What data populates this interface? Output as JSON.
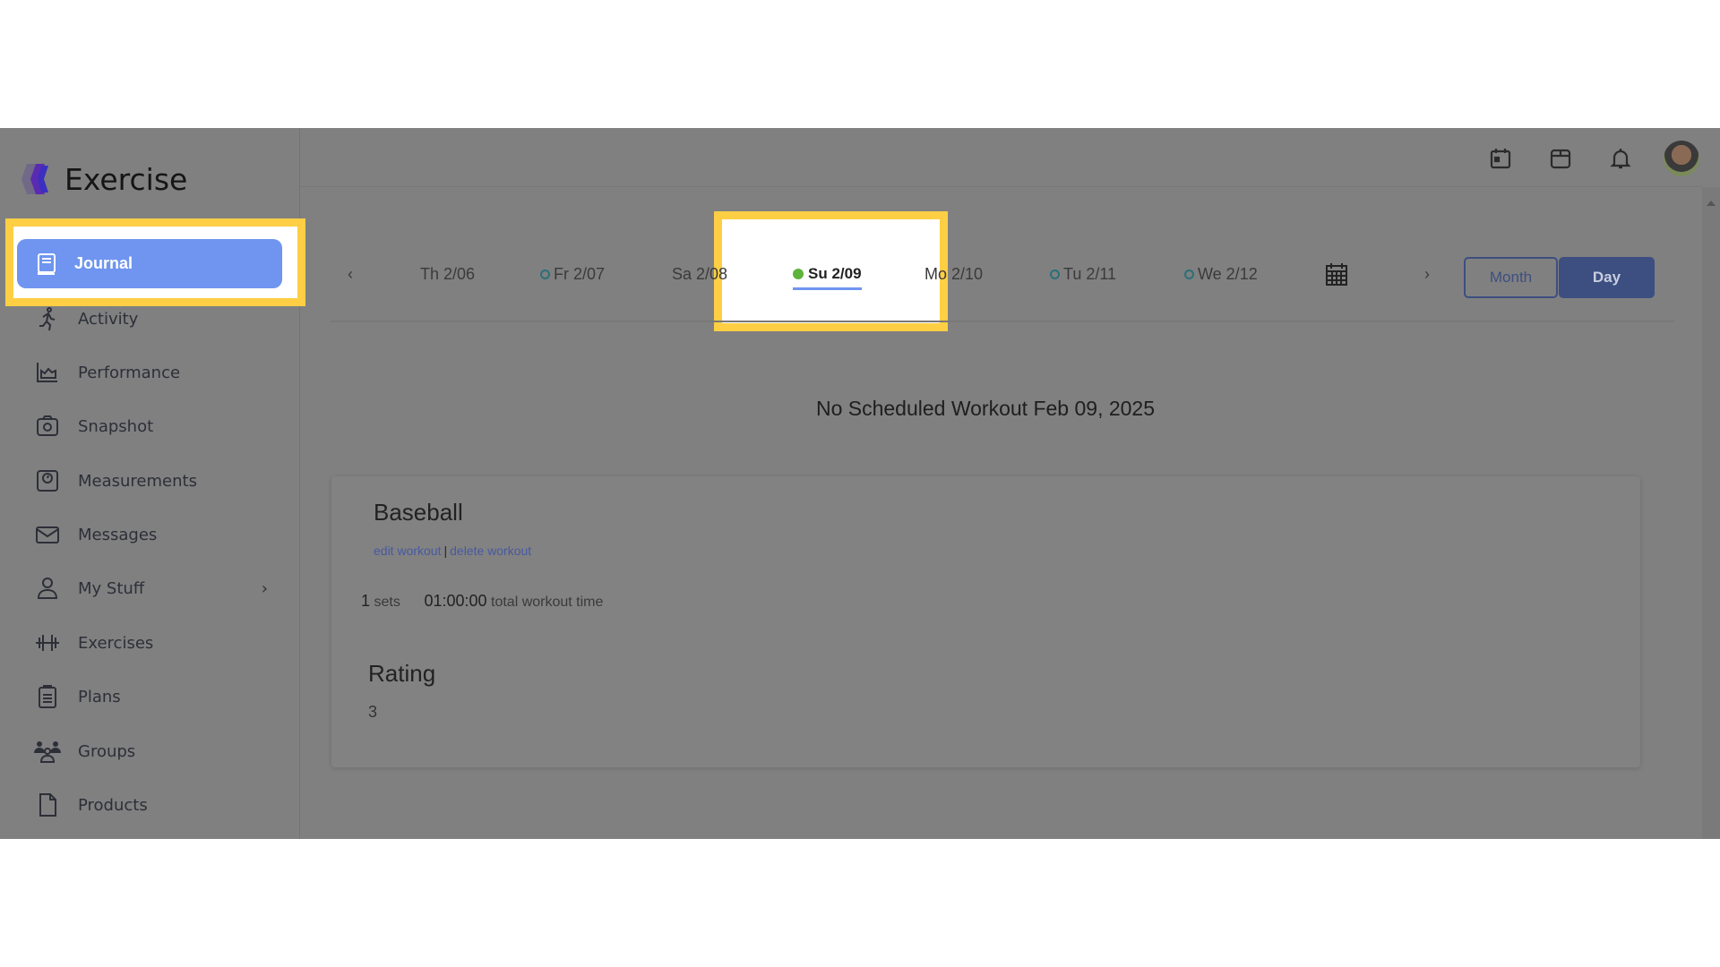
{
  "app": {
    "title": "Exercise"
  },
  "sidebar": {
    "items": [
      {
        "label": "Journal",
        "icon": "journal-icon",
        "active": true
      },
      {
        "label": "Activity",
        "icon": "running-icon"
      },
      {
        "label": "Performance",
        "icon": "chart-icon"
      },
      {
        "label": "Snapshot",
        "icon": "camera-icon"
      },
      {
        "label": "Measurements",
        "icon": "scale-icon"
      },
      {
        "label": "Messages",
        "icon": "mail-icon"
      },
      {
        "label": "My Stuff",
        "icon": "user-icon",
        "has_children": true
      },
      {
        "label": "Exercises",
        "icon": "dumbbell-icon"
      },
      {
        "label": "Plans",
        "icon": "clipboard-icon"
      },
      {
        "label": "Groups",
        "icon": "group-icon"
      },
      {
        "label": "Products",
        "icon": "file-icon"
      }
    ]
  },
  "topbar": {
    "icons": [
      "calendar-icon",
      "box-icon",
      "bell-icon",
      "avatar"
    ]
  },
  "dates": [
    {
      "label": "Th 2/06",
      "marker": "none"
    },
    {
      "label": "Fr 2/07",
      "marker": "ring"
    },
    {
      "label": "Sa 2/08",
      "marker": "none"
    },
    {
      "label": "Su 2/09",
      "marker": "dot",
      "selected": true
    },
    {
      "label": "Mo 2/10",
      "marker": "none"
    },
    {
      "label": "Tu 2/11",
      "marker": "ring"
    },
    {
      "label": "We 2/12",
      "marker": "ring"
    }
  ],
  "view_toggle": {
    "month": "Month",
    "day": "Day",
    "selected": "Day"
  },
  "main": {
    "no_workout": "No Scheduled Workout Feb 09, 2025",
    "workout": {
      "name": "Baseball",
      "edit": "edit workout",
      "separator": "|",
      "delete": "delete workout",
      "sets_value": "1",
      "sets_label": "sets",
      "time_value": "01:00:00",
      "time_label": "total workout time",
      "rating_title": "Rating",
      "rating_value": "3"
    }
  },
  "colors": {
    "accent": "#6f95f0",
    "highlight": "#fecf44",
    "day_button": "#3d4f80",
    "dot": "#5fb23a"
  }
}
